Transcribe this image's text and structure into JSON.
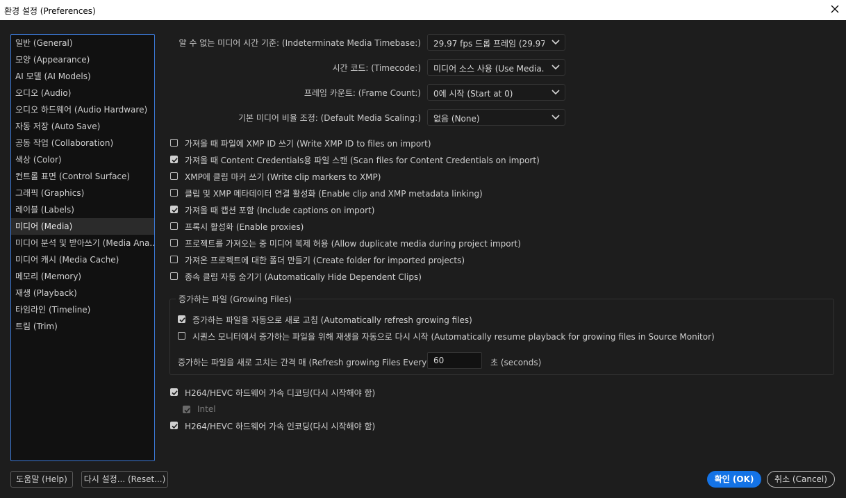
{
  "window": {
    "title": "환경 설정 (Preferences)"
  },
  "sidebar": {
    "items": [
      {
        "label": "일반 (General)"
      },
      {
        "label": "모양 (Appearance)"
      },
      {
        "label": "AI 모델 (AI Models)"
      },
      {
        "label": "오디오 (Audio)"
      },
      {
        "label": "오디오 하드웨어 (Audio Hardware)"
      },
      {
        "label": "자동 저장 (Auto Save)"
      },
      {
        "label": "공동 작업 (Collaboration)"
      },
      {
        "label": "색상 (Color)"
      },
      {
        "label": "컨트롤 표면 (Control Surface)"
      },
      {
        "label": "그래픽 (Graphics)"
      },
      {
        "label": "레이블 (Labels)"
      },
      {
        "label": "미디어 (Media)",
        "selected": true
      },
      {
        "label": "미디어 분석 및 받아쓰기 (Media Ana..."
      },
      {
        "label": "미디어 캐시 (Media Cache)"
      },
      {
        "label": "메모리 (Memory)"
      },
      {
        "label": "재생 (Playback)"
      },
      {
        "label": "타임라인 (Timeline)"
      },
      {
        "label": "트림 (Trim)"
      }
    ]
  },
  "settings": {
    "timebase": {
      "label": "알 수 없는 미디어 시간 기준: (Indeterminate Media Timebase:)",
      "value": "29.97 fps 드롭 프레임 (29.97 ..."
    },
    "timecode": {
      "label": "시간 코드: (Timecode:)",
      "value": "미디어 소스 사용 (Use Media..."
    },
    "frame_count": {
      "label": "프레임 카운트: (Frame Count:)",
      "value": "0에 시작 (Start at 0)"
    },
    "scaling": {
      "label": "기본 미디어 비율 조정: (Default Media Scaling:)",
      "value": "없음 (None)"
    }
  },
  "checkboxes": [
    {
      "label": "가져올 때 파일에 XMP ID 쓰기 (Write XMP ID to files on import)",
      "checked": false
    },
    {
      "label": "가져올 때 Content Credentials용 파일 스캔 (Scan files for Content Credentials on import)",
      "checked": true
    },
    {
      "label": "XMP에 클립 마커 쓰기 (Write clip markers to XMP)",
      "checked": false
    },
    {
      "label": "클립 및 XMP 메타데이터 연결 활성화 (Enable clip and XMP metadata linking)",
      "checked": false
    },
    {
      "label": "가져올 때 캡션 포함 (Include captions on import)",
      "checked": true
    },
    {
      "label": "프록시 활성화 (Enable proxies)",
      "checked": false
    },
    {
      "label": "프로젝트를 가져오는 중 미디어 복제 허용 (Allow duplicate media during project import)",
      "checked": false
    },
    {
      "label": "가져온 프로젝트에 대한 폴더 만들기 (Create folder for imported projects)",
      "checked": false
    },
    {
      "label": "종속 클립 자동 숨기기 (Automatically Hide Dependent Clips)",
      "checked": false
    }
  ],
  "growing_files": {
    "title": "증가하는 파일 (Growing Files)",
    "auto_refresh": {
      "label": "증가하는 파일을 자동으로 새로 고침 (Automatically refresh growing files)",
      "checked": true
    },
    "auto_resume": {
      "label": "시퀀스 모니터에서 증가하는 파일을 위해 재생을 자동으로 다시 시작 (Automatically resume playback for growing files in Source Monitor)",
      "checked": false
    },
    "interval_label": "증가하는 파일을 새로 고치는 간격 매 (Refresh growing Files Every)",
    "interval_value": "60",
    "interval_unit": "초 (seconds)"
  },
  "hardware": {
    "decode": {
      "label": "H264/HEVC 하드웨어 가속 디코딩(다시 시작해야 함)",
      "checked": true
    },
    "intel": {
      "label": "Intel",
      "checked": true
    },
    "encode": {
      "label": "H264/HEVC 하드웨어 가속 인코딩(다시 시작해야 함)",
      "checked": true
    }
  },
  "buttons": {
    "help": "도움말 (Help)",
    "reset": "다시 설정... (Reset...)",
    "ok": "확인 (OK)",
    "cancel": "취소 (Cancel)"
  },
  "colors": {
    "accent": "#1473e6",
    "background": "#1d1d1d",
    "sidebar_border": "#3c7ad8"
  },
  "icons": {
    "close": "close-icon",
    "chevron": "chevron-down-icon",
    "check": "check-icon"
  }
}
